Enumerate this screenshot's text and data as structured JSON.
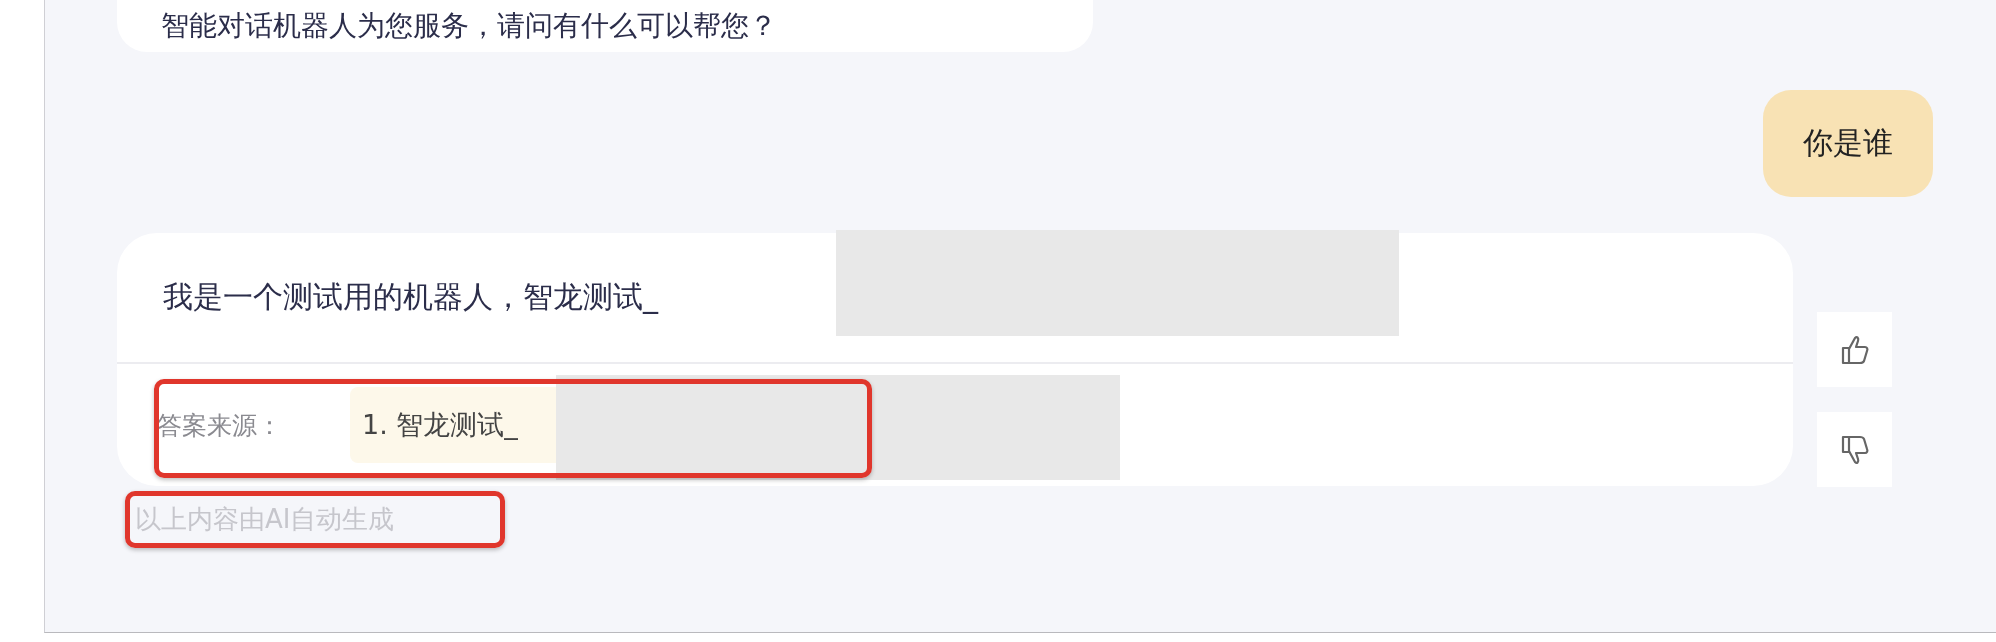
{
  "greeting": {
    "text": "智能对话机器人为您服务，请问有什么可以帮您？"
  },
  "user_message": {
    "text": "你是谁"
  },
  "answer": {
    "text": "我是一个测试用的机器人，智龙测试_",
    "source_label": "答案来源：",
    "sources": [
      "1. 智龙测试_"
    ]
  },
  "footer_note": "以上内容由AI自动生成"
}
